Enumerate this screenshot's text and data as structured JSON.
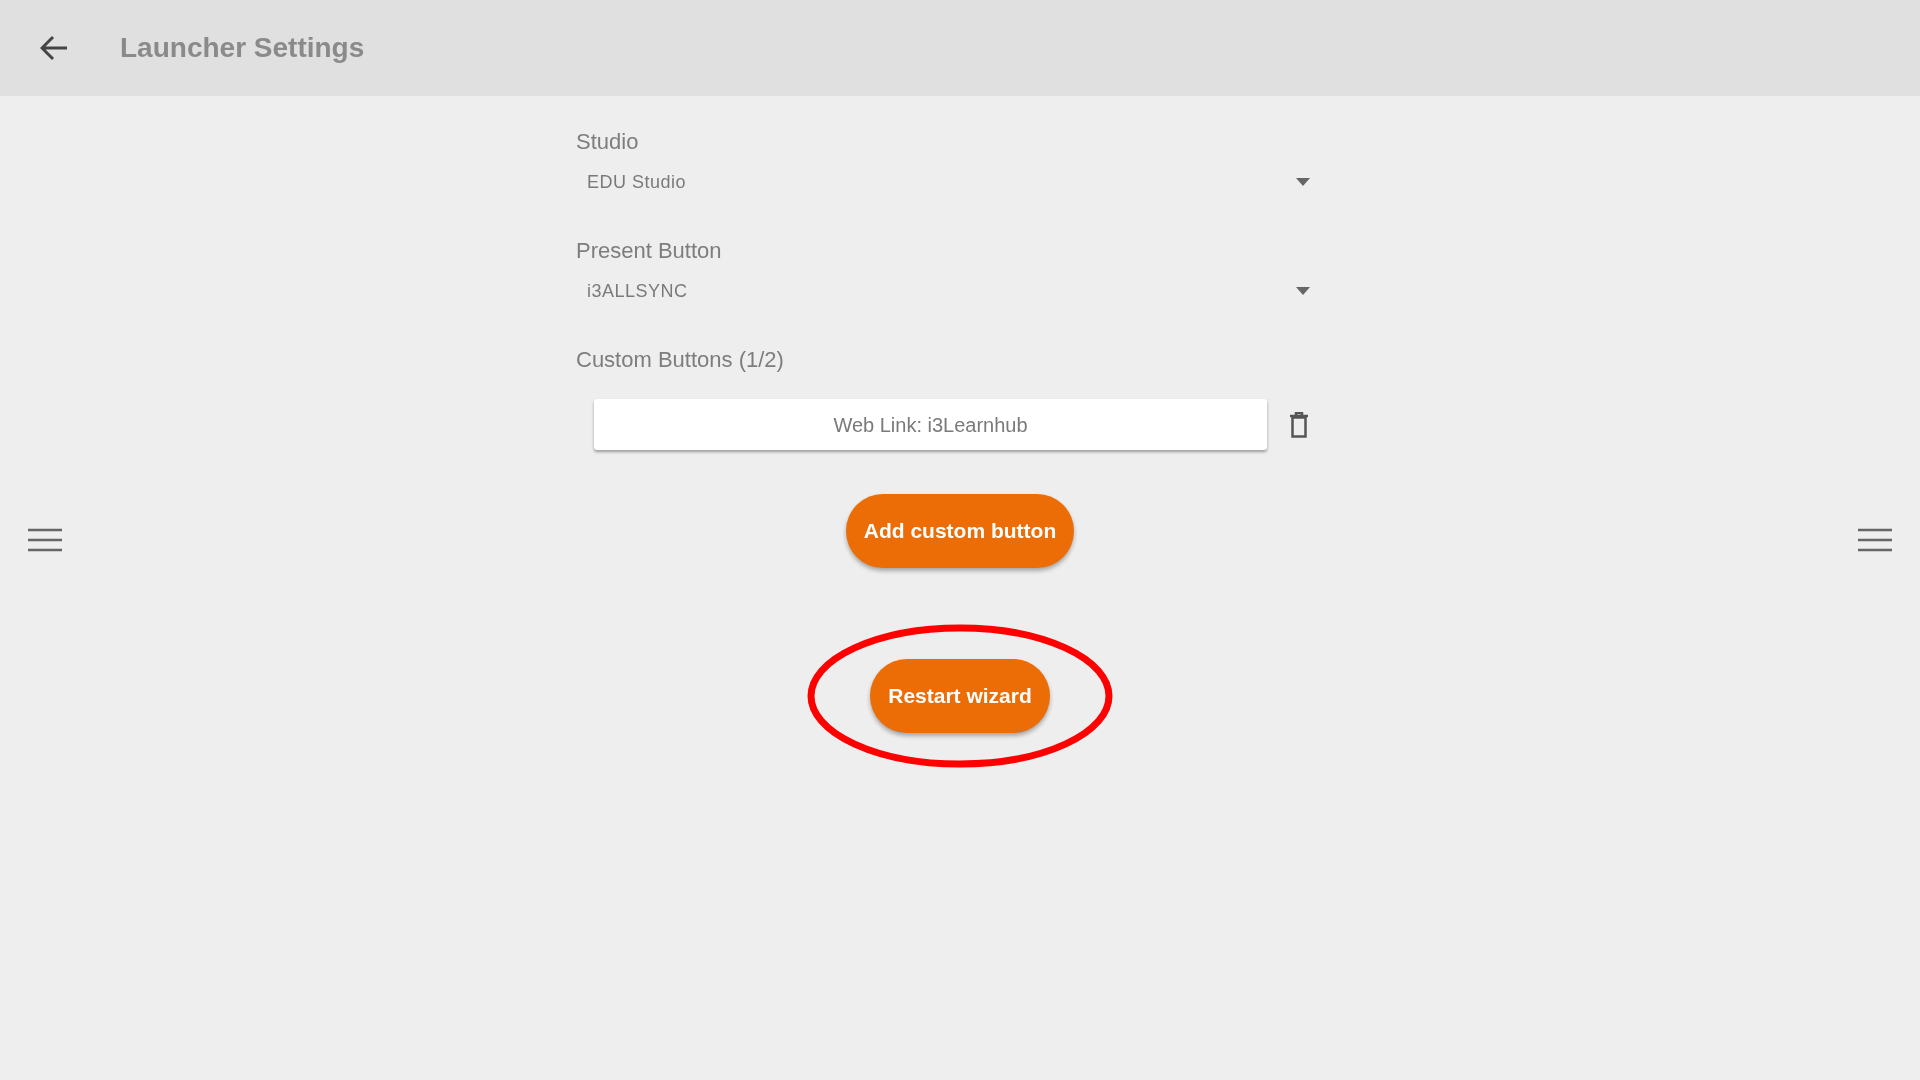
{
  "header": {
    "title": "Launcher Settings"
  },
  "settings": [
    {
      "kind": "dropdown",
      "label": "Studio",
      "value": "EDU Studio"
    },
    {
      "kind": "dropdown",
      "label": "Present Button",
      "value": "i3ALLSYNC"
    }
  ],
  "custom_buttons": {
    "label": "Custom Buttons (1/2)",
    "items": [
      {
        "label": "Web Link: i3Learnhub"
      }
    ]
  },
  "actions": [
    {
      "label": "Add custom button",
      "highlighted": false
    },
    {
      "label": "Restart wizard",
      "highlighted": true
    }
  ]
}
